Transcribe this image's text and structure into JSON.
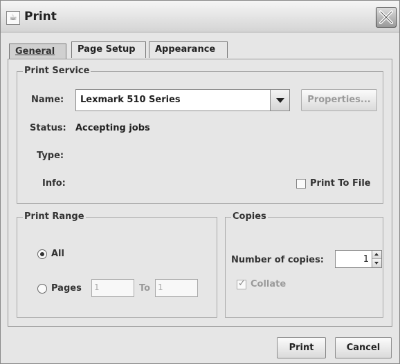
{
  "window": {
    "title": "Print"
  },
  "tabs": [
    {
      "label": "General",
      "active": true
    },
    {
      "label": "Page Setup",
      "active": false
    },
    {
      "label": "Appearance",
      "active": false
    }
  ],
  "print_service": {
    "title": "Print Service",
    "name_label": "Name:",
    "printer_name": "Lexmark 510 Series",
    "properties_button": "Properties...",
    "status_label": "Status:",
    "status_value": "Accepting jobs",
    "type_label": "Type:",
    "info_label": "Info:",
    "print_to_file_label": "Print To File",
    "print_to_file_checked": false
  },
  "print_range": {
    "title": "Print Range",
    "all_label": "All",
    "pages_label": "Pages",
    "from_value": "1",
    "to_label": "To",
    "to_value": "1",
    "selected": "All"
  },
  "copies": {
    "title": "Copies",
    "number_label": "Number of copies:",
    "number_value": "1",
    "collate_label": "Collate",
    "collate_checked": true
  },
  "footer": {
    "print_button": "Print",
    "cancel_button": "Cancel"
  }
}
